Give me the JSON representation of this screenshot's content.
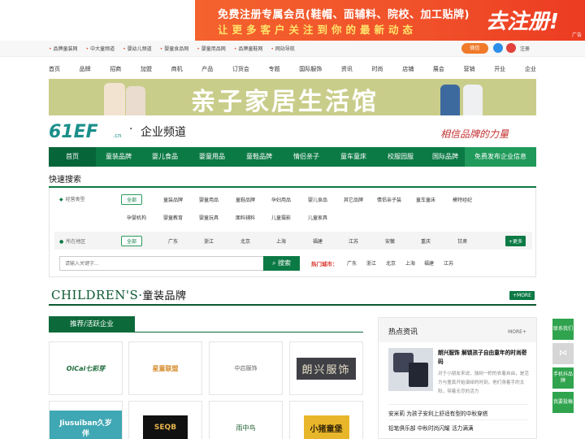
{
  "top_banner": {
    "line1": "免费注册专属会员(鞋帽、面辅料、院校、加工贴牌)",
    "line2": "让更多客户关注到你的最新动态",
    "cta": "去注册!",
    "ad_tag": "广告"
  },
  "utility_bar": {
    "links": [
      "品牌童装网",
      "中大童频道",
      "婴幼儿频道",
      "婴童食品网",
      "婴童用品网",
      "品牌童鞋网",
      "网站导航"
    ],
    "wechat": "微信",
    "login": "注册"
  },
  "main_nav": [
    "首页",
    "品牌",
    "招商",
    "加盟",
    "商机",
    "产品",
    "订货会",
    "专题",
    "国际服饰",
    "资讯",
    "时尚",
    "店铺",
    "展会",
    "营销",
    "开业",
    "企业"
  ],
  "ad2": {
    "text": "亲子家居生活馆"
  },
  "header": {
    "logo": "61EF",
    "logo_suffix": ".cn",
    "separator": "·",
    "channel": "企业频道",
    "slogan": "相信品牌的力量"
  },
  "channel_nav": {
    "items": [
      "首页",
      "童装品牌",
      "婴儿食品",
      "婴童用品",
      "童鞋品牌",
      "情侣亲子",
      "童车童床",
      "校服园服",
      "国际品牌"
    ],
    "free_release": "免费发布企业信息"
  },
  "quick_search": {
    "title": "快速搜索",
    "business_label": "经营类型",
    "business_row1": [
      "全部",
      "童装品牌",
      "婴童用品",
      "童鞋品牌",
      "孕妇用品",
      "婴儿食品",
      "其它品牌",
      "情侣亲子装",
      "童车童床",
      "模特经纪"
    ],
    "business_row2": [
      "孕婴机构",
      "婴童教育",
      "婴童玩具",
      "面料辅料",
      "儿童摄影",
      "儿童家具"
    ],
    "region_label": "所在地区",
    "regions": [
      "全部",
      "广东",
      "浙江",
      "北京",
      "上海",
      "福建",
      "江苏",
      "安徽",
      "重庆",
      "甘肃"
    ],
    "more": "+更多",
    "keyword_placeholder": "请输入关键字...",
    "search_button": "搜索",
    "hot_label": "热门城市：",
    "hot_cities": [
      "广东",
      "浙江",
      "北京",
      "上海",
      "福建",
      "江苏"
    ]
  },
  "children_section": {
    "heading_en": "CHILDREN'S",
    "heading_sep": "·",
    "heading_cn": "童装品牌",
    "more": "+MORE",
    "tab": "推荐/活跃企业",
    "brands_row1": [
      "OiCai七彩芽",
      "星童联盟",
      "中启服饰",
      "朗兴服饰"
    ],
    "brands_row2": [
      "Jiusuiban久岁伴",
      "SEQB",
      "雨中鸟",
      "小猪童堡"
    ]
  },
  "news": {
    "title": "热点资讯",
    "more": "MORE+",
    "featured_title": "朗兴服饰 解锁孩子自由童年的时尚密码",
    "featured_desc": "对于小朋友来说，独树一帜的衣着自由，是活力与童真开始演绎的时刻，他们身着手的太阳，带着无尽的活力",
    "items": [
      "安米莉 为孩子安利上舒适有型的中秋穿搭",
      "铅笔俱乐部 中秋时尚闪耀 活力满满"
    ]
  },
  "float_bar": [
    "联系我们",
    "分享",
    "手机抖品牌",
    "我要投稿"
  ],
  "colors": {
    "primary_green": "#0c7a45",
    "banner_orange": "#f0502a",
    "hot_red": "#d9342a"
  }
}
